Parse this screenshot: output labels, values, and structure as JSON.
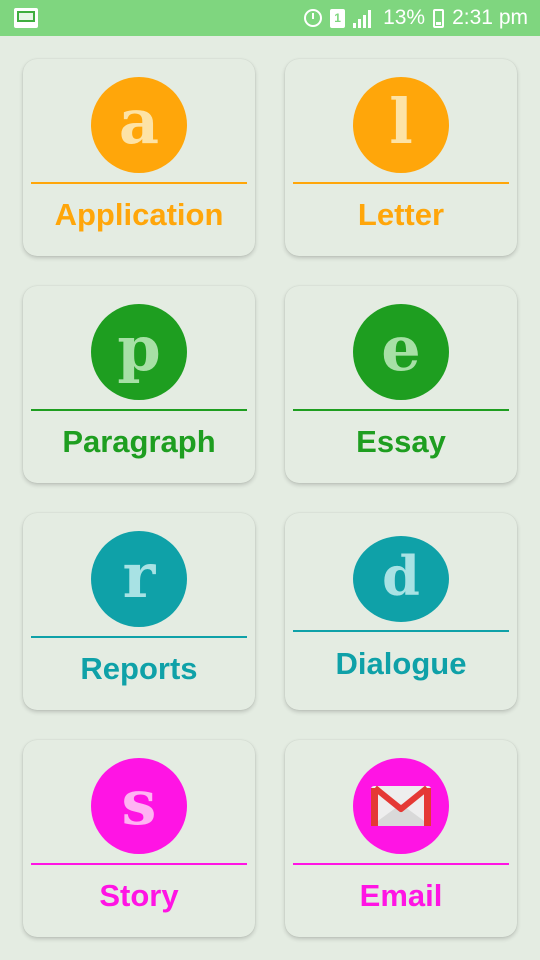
{
  "status_bar": {
    "battery": "13%",
    "time": "2:31 pm",
    "sim": "1",
    "icons": [
      "app-icon",
      "alarm-icon",
      "sim-icon",
      "signal-icon",
      "battery-charging-icon"
    ]
  },
  "colors": {
    "orange": "#ffa60a",
    "orange_glyph": "#fde3a6",
    "green": "#1e9e20",
    "green_glyph": "#a7e0a6",
    "teal": "#0fa1a8",
    "teal_glyph": "#a8e2e4",
    "magenta": "#ff14e4",
    "magenta_glyph": "#ffb3f3",
    "background": "#e4ece2",
    "status_bar": "#7fd67f"
  },
  "menu": {
    "application": {
      "label": "Application",
      "glyph": "a"
    },
    "letter": {
      "label": "Letter",
      "glyph": "l"
    },
    "paragraph": {
      "label": "Paragraph",
      "glyph": "p"
    },
    "essay": {
      "label": "Essay",
      "glyph": "e"
    },
    "reports": {
      "label": "Reports",
      "glyph": "r"
    },
    "dialogue": {
      "label": "Dialogue",
      "glyph": "d"
    },
    "story": {
      "label": "Story",
      "glyph": "s"
    },
    "email": {
      "label": "Email",
      "icon": "gmail-envelope-icon"
    }
  }
}
